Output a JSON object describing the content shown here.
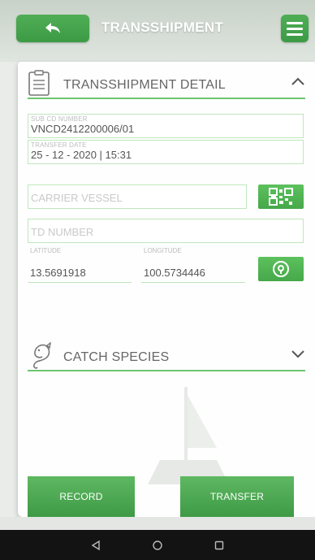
{
  "header": {
    "title": "TRANSSHIPMENT",
    "back_icon": "back-arrow-icon",
    "menu_icon": "hamburger-menu-icon"
  },
  "detail": {
    "section_title": "TRANSSHIPMENT DETAIL",
    "sub_cd_caption": "SUB CD NUMBER",
    "sub_cd_value": "VNCD2412200006/01",
    "transfer_date_caption": "TRANSFER DATE",
    "transfer_date_value": "25 - 12 - 2020 | 15:31",
    "carrier_vessel_placeholder": "CARRIER VESSEL",
    "td_number_placeholder": "TD NUMBER",
    "latitude_caption": "LATITUDE",
    "latitude_value": "13.5691918",
    "longitude_caption": "LONGITUDE",
    "longitude_value": "100.5734446"
  },
  "species": {
    "section_title": "CATCH SPECIES"
  },
  "actions": {
    "record_label": "RECORD",
    "transfer_label": "TRANSFER"
  },
  "colors": {
    "accent_green": "#4cae50",
    "field_border": "#bfe6bd",
    "section_line": "#6cc56f"
  }
}
